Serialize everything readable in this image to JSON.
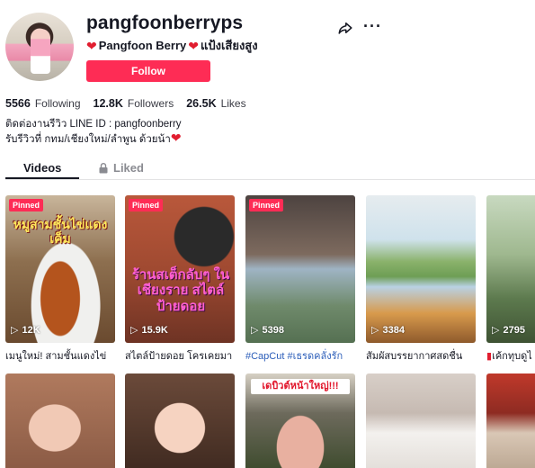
{
  "profile": {
    "username": "pangfoonberryps",
    "display_name": "Pangfoon Berry",
    "display_suffix": "แป้งเสียงสูง",
    "follow_label": "Follow",
    "stats": [
      {
        "value": "5566",
        "label": "Following"
      },
      {
        "value": "12.8K",
        "label": "Followers"
      },
      {
        "value": "26.5K",
        "label": "Likes"
      }
    ],
    "bio_line1": "ติดต่องานรีวิว LINE ID : pangfoonberry",
    "bio_line2": "รับรีวิวที่ กทม/เชียงใหม่/ลำพูน ด้วยน้า"
  },
  "tabs": {
    "videos": "Videos",
    "liked": "Liked"
  },
  "videos": [
    {
      "pinned": "Pinned",
      "views": "12K",
      "caption": "เมนูใหม่! สามชั้นแดงไข่",
      "overlay": "หมูสามชั้นไข่แดงเค็ม"
    },
    {
      "pinned": "Pinned",
      "views": "15.9K",
      "caption": "สไตล์ป้ายดอย โครเคยมา",
      "overlay": "ร้านสเต็กลับๆ ในเชียงราย สไตล์ป้ายดอย"
    },
    {
      "pinned": "Pinned",
      "views": "5398",
      "caption": "#CapCut #เธรดคลั่งรัก"
    },
    {
      "views": "3384",
      "caption": "สัมผัสบรรยากาศสดชื่น"
    },
    {
      "views": "2795",
      "caption": "เค้กทุบดูไ"
    }
  ],
  "row2": [
    {
      "overlay": ""
    },
    {
      "overlay": ""
    },
    {
      "overlay": "เดบิวต์หน้าใหญ่!!!"
    },
    {
      "overlay": ""
    },
    {
      "overlay": ""
    }
  ],
  "colors": {
    "accent": "#fe2c55",
    "heart": "#e11d2f",
    "hashtag": "#2b5db9"
  }
}
